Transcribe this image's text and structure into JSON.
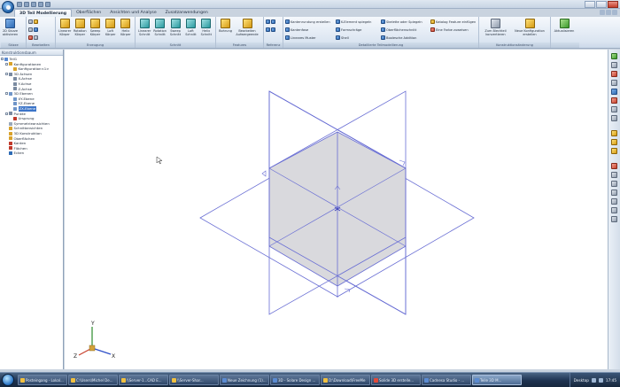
{
  "ribbon": {
    "tabs": [
      "3D Teil Modellierung",
      "Oberflächen",
      "Ansichten und Analyse",
      "Zusatzanwendungen"
    ],
    "active_tab": 0,
    "groups": {
      "skizze": {
        "label": "Skizze",
        "buttons": [
          "2D Skizze\naktivieren"
        ]
      },
      "bearbeiten": {
        "label": "Bearbeiten"
      },
      "erzeugung": {
        "label": "Erzeugung",
        "buttons": [
          "Linearer\nKörper",
          "Rotation\nKörper",
          "Sweep\nKörper",
          "Loft\nKörper",
          "Helix\nKörper"
        ]
      },
      "schnitt": {
        "label": "Schnitt",
        "buttons": [
          "Linearer\nSchnitt",
          "Rotation\nSchnitt",
          "Sweep\nSchnitt",
          "Loft\nSchnitt",
          "Helix\nSchnitt"
        ]
      },
      "features": {
        "label": "Features",
        "buttons": [
          "Bohrung",
          "Bearbeiten\nAufwergeende"
        ]
      },
      "referenz": {
        "label": "Referenz"
      },
      "detail": {
        "label": "Detaillierte Teilmodellierung",
        "col1": [
          "Kantenrundung erstellen",
          "Kantenfase",
          "Lineares Muster"
        ],
        "col2": [
          "K-Element spiegeln",
          "Formschräge",
          "Shell"
        ],
        "col3": [
          "Skelette oder Spiegeln",
          "Oberflächenschnitt",
          "Boolesche Addition"
        ],
        "col4": [
          "Katalog Feature einfügen",
          "Eine Farbe zuweisen"
        ]
      },
      "konstruktion": {
        "label": "Konstruktionsänderung",
        "buttons": [
          "Zum Blechteil\nkonvertieren",
          "Neue Konfiguration\nerstellen"
        ]
      },
      "sonstiges": {
        "buttons": [
          "Aktualisieren"
        ]
      }
    }
  },
  "panel": {
    "title": "Konstruktionsbaum",
    "tree": [
      {
        "label": "Teil1",
        "indent": 0,
        "toggle": true,
        "icon": "part-icon",
        "color": "#5b8bd1"
      },
      {
        "label": "Konfigurationen",
        "indent": 1,
        "toggle": true,
        "icon": "config-icon",
        "color": "#d9a22b"
      },
      {
        "label": "Konfiguration<1>",
        "indent": 2,
        "toggle": false,
        "icon": "config-icon",
        "color": "#d9a22b"
      },
      {
        "label": "3D Achsen",
        "indent": 1,
        "toggle": true,
        "icon": "axes-icon",
        "color": "#7a8aa0"
      },
      {
        "label": "X-Achse",
        "indent": 2,
        "toggle": false,
        "icon": "axis-icon",
        "color": "#7a8aa0"
      },
      {
        "label": "Y-Achse",
        "indent": 2,
        "toggle": false,
        "icon": "axis-icon",
        "color": "#7a8aa0"
      },
      {
        "label": "Z-Achse",
        "indent": 2,
        "toggle": false,
        "icon": "axis-icon",
        "color": "#7a8aa0"
      },
      {
        "label": "3D Ebenen",
        "indent": 1,
        "toggle": true,
        "icon": "planes-icon",
        "color": "#6f95c8"
      },
      {
        "label": "XY-Ebene",
        "indent": 2,
        "toggle": false,
        "icon": "plane-icon",
        "color": "#6f95c8"
      },
      {
        "label": "YZ-Ebene",
        "indent": 2,
        "toggle": false,
        "icon": "plane-icon",
        "color": "#6f95c8"
      },
      {
        "label": "ZX-Ebene",
        "indent": 2,
        "toggle": false,
        "icon": "plane-icon",
        "color": "#6f95c8",
        "selected": true
      },
      {
        "label": "Punkte",
        "indent": 1,
        "toggle": true,
        "icon": "points-icon",
        "color": "#7a8aa0"
      },
      {
        "label": "Ursprung",
        "indent": 2,
        "toggle": false,
        "icon": "origin-icon",
        "color": "#c0392b"
      },
      {
        "label": "Symmetrieansichten",
        "indent": 1,
        "toggle": false,
        "icon": "symmetry-icon",
        "color": "#9aa8b9"
      },
      {
        "label": "Schnittansichten",
        "indent": 1,
        "toggle": false,
        "icon": "section-icon",
        "color": "#d9a22b"
      },
      {
        "label": "3D Konstruktion",
        "indent": 1,
        "toggle": false,
        "icon": "construction-icon",
        "color": "#d9a22b"
      },
      {
        "label": "Oberflächen",
        "indent": 1,
        "toggle": false,
        "icon": "surface-icon",
        "color": "#d9a22b"
      },
      {
        "label": "Kanten",
        "indent": 1,
        "toggle": false,
        "icon": "edges-icon",
        "color": "#c0392b"
      },
      {
        "label": "Flächen",
        "indent": 1,
        "toggle": false,
        "icon": "faces-icon",
        "color": "#c0392b"
      },
      {
        "label": "Ecken",
        "indent": 1,
        "toggle": false,
        "icon": "vertices-icon",
        "color": "#2d6bb5"
      }
    ]
  },
  "viewport": {
    "triad": {
      "x_label": "X",
      "y_label": "Y",
      "z_label": "Z"
    }
  },
  "taskbar": {
    "items": [
      {
        "label": "Posteingang - Lokal...",
        "color": "#f0c040"
      },
      {
        "label": "C:\\Users\\Michel De...",
        "color": "#f0c040"
      },
      {
        "label": "\\\\Server-1...CAD E...",
        "color": "#f0c040"
      },
      {
        "label": "\\\\Server-Shar...",
        "color": "#f0c040"
      },
      {
        "label": "Neue Zeichnung (1)...",
        "color": "#5b8bd1"
      },
      {
        "label": "3D - Solare Design ...",
        "color": "#5b8bd1"
      },
      {
        "label": "D:\\Download\\FreeMe",
        "color": "#f0c040"
      },
      {
        "label": "Solide 3D erstelle...",
        "color": "#e04a3a"
      },
      {
        "label": "Cadnesa Studio - ...",
        "color": "#5b8bd1"
      },
      {
        "label": "Teile 3D M...",
        "color": "#5b8bd1",
        "active": true
      }
    ],
    "tray_label": "Desktop",
    "clock": "17:45"
  }
}
